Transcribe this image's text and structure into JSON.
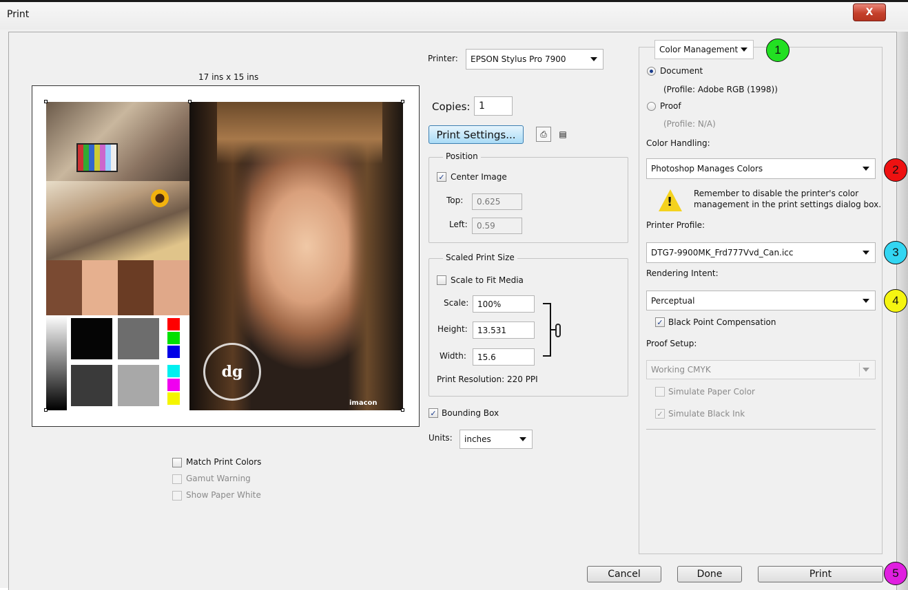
{
  "window": {
    "title": "Print",
    "close_label": "X"
  },
  "preview": {
    "size_caption": "17 ins x 15 ins",
    "watermark_text": "dg",
    "imacon_text": "imacon"
  },
  "printer": {
    "label": "Printer:",
    "value": "EPSON Stylus Pro 7900"
  },
  "copies": {
    "label": "Copies:",
    "value": "1"
  },
  "print_settings_label": "Print Settings...",
  "position": {
    "legend": "Position",
    "center_image_label": "Center Image",
    "center_image_checked": true,
    "top_label": "Top:",
    "top_value": "0.625",
    "left_label": "Left:",
    "left_value": "0.59"
  },
  "scaled": {
    "legend": "Scaled Print Size",
    "scale_to_fit_label": "Scale to Fit Media",
    "scale_to_fit_checked": false,
    "scale_label": "Scale:",
    "scale_value": "100%",
    "height_label": "Height:",
    "height_value": "13.531",
    "width_label": "Width:",
    "width_value": "15.6",
    "resolution_text": "Print Resolution: 220 PPI"
  },
  "bounding_box": {
    "label": "Bounding Box",
    "checked": true
  },
  "units": {
    "label": "Units:",
    "value": "inches"
  },
  "bottom_left": {
    "match_print_colors": "Match Print Colors",
    "gamut_warning": "Gamut Warning",
    "show_paper_white": "Show Paper White"
  },
  "color_mgmt": {
    "section_dropdown": "Color Management",
    "document_label": "Document",
    "document_profile": "(Profile: Adobe RGB (1998))",
    "proof_label": "Proof",
    "proof_profile": "(Profile: N/A)",
    "selected_source": "Document",
    "color_handling_label": "Color Handling:",
    "color_handling_value": "Photoshop Manages Colors",
    "warning_text_line1": "Remember to disable the printer's color",
    "warning_text_line2": "management in the print settings dialog box.",
    "printer_profile_label": "Printer Profile:",
    "printer_profile_value": "DTG7-9900MK_Frd777Vvd_Can.icc",
    "rendering_intent_label": "Rendering Intent:",
    "rendering_intent_value": "Perceptual",
    "black_point_label": "Black Point Compensation",
    "black_point_checked": true,
    "proof_setup_label": "Proof Setup:",
    "proof_setup_value": "Working CMYK",
    "simulate_paper_label": "Simulate Paper Color",
    "simulate_black_label": "Simulate Black Ink"
  },
  "buttons": {
    "cancel": "Cancel",
    "done": "Done",
    "print": "Print"
  },
  "callouts": [
    {
      "number": "1",
      "color": "#22e022"
    },
    {
      "number": "2",
      "color": "#ee1111"
    },
    {
      "number": "3",
      "color": "#33d6f2"
    },
    {
      "number": "4",
      "color": "#f5f511"
    },
    {
      "number": "5",
      "color": "#e01fe0"
    }
  ]
}
